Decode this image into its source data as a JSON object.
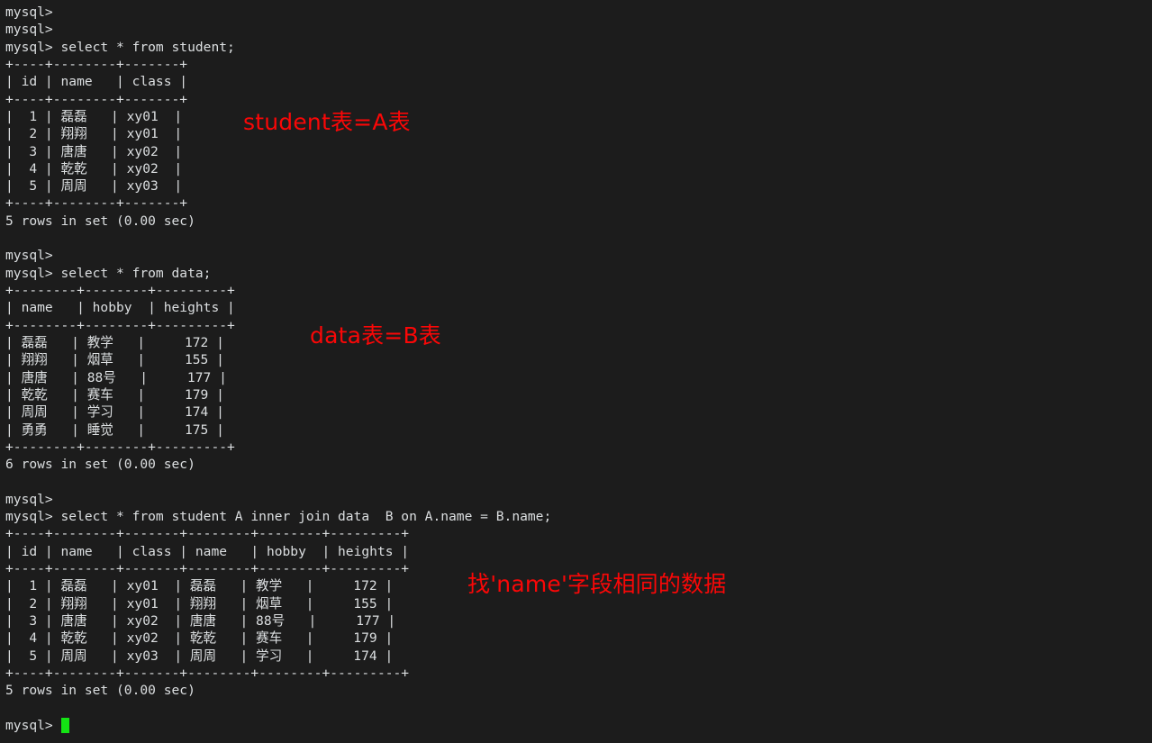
{
  "terminal": {
    "prompt": "mysql>",
    "background_color": "#1c1c1c",
    "text_color": "#dcdfe1",
    "cursor_color": "#14e414",
    "annotation_color": "#fa0707",
    "lines": [
      "mysql>",
      "mysql>",
      "mysql> select * from student;",
      "+----+--------+-------+",
      "| id | name   | class |",
      "+----+--------+-------+",
      "|  1 | 磊磊   | xy01  |",
      "|  2 | 翔翔   | xy01  |",
      "|  3 | 唐唐   | xy02  |",
      "|  4 | 乾乾   | xy02  |",
      "|  5 | 周周   | xy03  |",
      "+----+--------+-------+",
      "5 rows in set (0.00 sec)",
      "",
      "mysql>",
      "mysql> select * from data;",
      "+--------+--------+---------+",
      "| name   | hobby  | heights |",
      "+--------+--------+---------+",
      "| 磊磊   | 教学   |     172 |",
      "| 翔翔   | 烟草   |     155 |",
      "| 唐唐   | 88号   |     177 |",
      "| 乾乾   | 赛车   |     179 |",
      "| 周周   | 学习   |     174 |",
      "| 勇勇   | 睡觉   |     175 |",
      "+--------+--------+---------+",
      "6 rows in set (0.00 sec)",
      "",
      "mysql>",
      "mysql> select * from student A inner join data  B on A.name = B.name;",
      "+----+--------+-------+--------+--------+---------+",
      "| id | name   | class | name   | hobby  | heights |",
      "+----+--------+-------+--------+--------+---------+",
      "|  1 | 磊磊   | xy01  | 磊磊   | 教学   |     172 |",
      "|  2 | 翔翔   | xy01  | 翔翔   | 烟草   |     155 |",
      "|  3 | 唐唐   | xy02  | 唐唐   | 88号   |     177 |",
      "|  4 | 乾乾   | xy02  | 乾乾   | 赛车   |     179 |",
      "|  5 | 周周   | xy03  | 周周   | 学习   |     174 |",
      "+----+--------+-------+--------+--------+---------+",
      "5 rows in set (0.00 sec)",
      ""
    ],
    "final_prompt": "mysql> "
  },
  "queries": {
    "q1": "select * from student;",
    "q2": "select * from data;",
    "q3": "select * from student A inner join data  B on A.name = B.name;"
  },
  "results": {
    "student": {
      "columns": [
        "id",
        "name",
        "class"
      ],
      "rows": [
        [
          "1",
          "磊磊",
          "xy01"
        ],
        [
          "2",
          "翔翔",
          "xy01"
        ],
        [
          "3",
          "唐唐",
          "xy02"
        ],
        [
          "4",
          "乾乾",
          "xy02"
        ],
        [
          "5",
          "周周",
          "xy03"
        ]
      ],
      "footer": "5 rows in set (0.00 sec)"
    },
    "data": {
      "columns": [
        "name",
        "hobby",
        "heights"
      ],
      "rows": [
        [
          "磊磊",
          "教学",
          "172"
        ],
        [
          "翔翔",
          "烟草",
          "155"
        ],
        [
          "唐唐",
          "88号",
          "177"
        ],
        [
          "乾乾",
          "赛车",
          "179"
        ],
        [
          "周周",
          "学习",
          "174"
        ],
        [
          "勇勇",
          "睡觉",
          "175"
        ]
      ],
      "footer": "6 rows in set (0.00 sec)"
    },
    "join": {
      "columns": [
        "id",
        "name",
        "class",
        "name",
        "hobby",
        "heights"
      ],
      "rows": [
        [
          "1",
          "磊磊",
          "xy01",
          "磊磊",
          "教学",
          "172"
        ],
        [
          "2",
          "翔翔",
          "xy01",
          "翔翔",
          "烟草",
          "155"
        ],
        [
          "3",
          "唐唐",
          "xy02",
          "唐唐",
          "88号",
          "177"
        ],
        [
          "4",
          "乾乾",
          "xy02",
          "乾乾",
          "赛车",
          "179"
        ],
        [
          "5",
          "周周",
          "xy03",
          "周周",
          "学习",
          "174"
        ]
      ],
      "footer": "5 rows in set (0.00 sec)"
    }
  },
  "annotations": {
    "student_table": "student表=A表",
    "data_table": "data表=B表",
    "join_note": "找'name'字段相同的数据"
  }
}
